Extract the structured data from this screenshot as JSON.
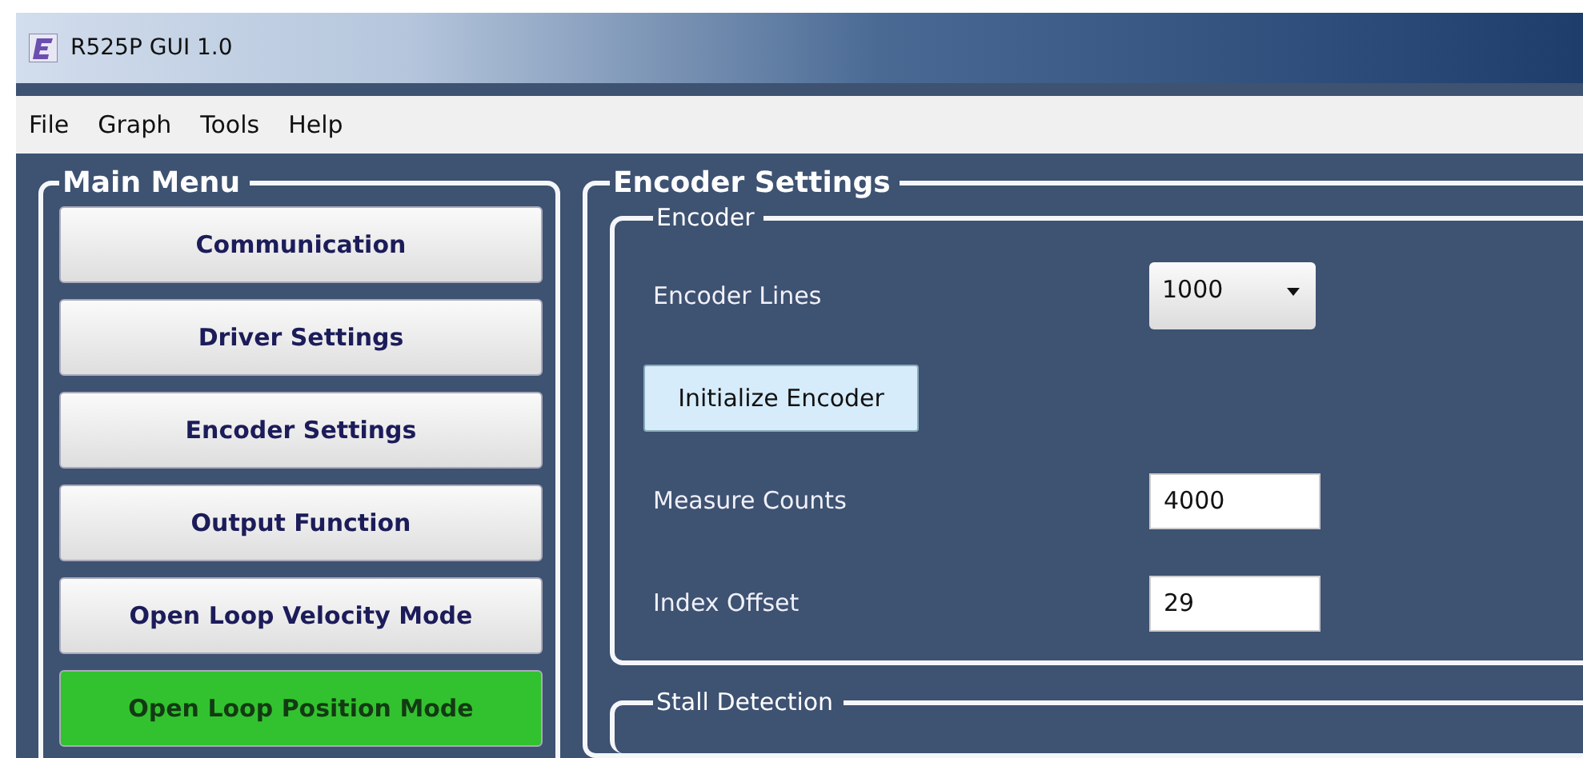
{
  "window": {
    "title": "R525P GUI 1.0"
  },
  "menu_bar": [
    "File",
    "Graph",
    "Tools",
    "Help"
  ],
  "main_menu": {
    "title": "Main Menu",
    "buttons": [
      {
        "label": "Communication",
        "selected": false
      },
      {
        "label": "Driver Settings",
        "selected": false
      },
      {
        "label": "Encoder Settings",
        "selected": false
      },
      {
        "label": "Output Function",
        "selected": false
      },
      {
        "label": "Open Loop Velocity Mode",
        "selected": false
      },
      {
        "label": "Open Loop Position Mode",
        "selected": true
      }
    ]
  },
  "encoder_settings": {
    "title": "Encoder Settings",
    "encoder": {
      "title": "Encoder",
      "rows": [
        {
          "kind": "dropdown",
          "label": "Encoder Lines",
          "value": "1000"
        },
        {
          "kind": "button",
          "label": "Initialize Encoder"
        },
        {
          "kind": "input",
          "label": "Measure Counts",
          "value": "4000"
        },
        {
          "kind": "input",
          "label": "Index Offset",
          "value": "29"
        }
      ]
    },
    "stall_detection": {
      "title": "Stall Detection"
    }
  }
}
